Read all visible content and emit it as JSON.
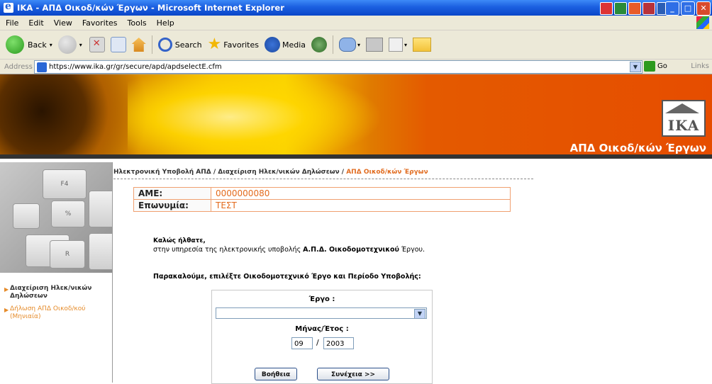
{
  "window": {
    "title": "IKA - ΑΠΔ Οικοδ/κών Έργων - Microsoft Internet Explorer"
  },
  "menu": [
    "File",
    "Edit",
    "View",
    "Favorites",
    "Tools",
    "Help"
  ],
  "toolbar": {
    "back": "Back",
    "search": "Search",
    "favorites": "Favorites",
    "media": "Media"
  },
  "address": {
    "label": "Address",
    "url": "https://www.ika.gr/gr/secure/apd/apdselectE.cfm",
    "go": "Go",
    "links": "Links"
  },
  "banner": {
    "logo_text": "IKA",
    "title": "ΑΠΔ Οικοδ/κών Έργων"
  },
  "breadcrumb": {
    "part1": "Ηλεκτρονική Υποβολή ΑΠΔ / ",
    "part2": "Διαχείριση Ηλεκ/νικών Δηλώσεων / ",
    "current": "ΑΠΔ Οικοδ/κών Έργων"
  },
  "info": {
    "ame_label": "AME:",
    "ame_value": "0000000080",
    "name_label": "Επωνυμία:",
    "name_value": "ΤΕΣΤ"
  },
  "welcome": {
    "title": "Καλώς ήλθατε,",
    "text_before": "στην υπηρεσία της ηλεκτρονικής υποβολής ",
    "text_bold": "Α.Π.Δ. Οικοδομοτεχνικού",
    "text_after": " Έργου."
  },
  "prompt": "Παρακαλούμε, επιλέξτε Οικοδομοτεχνικό Έργο και Περίοδο Υποβολής:",
  "form": {
    "ergo_label": "Έργο :",
    "ergo_value": "",
    "month_label": "Μήνας/Έτος :",
    "month": "09",
    "separator": "/",
    "year": "2003",
    "help_button": "Βοήθεια",
    "next_button": "Συνέχεια >>"
  },
  "sidebar": {
    "items": [
      {
        "label": "Διαχείριση Ηλεκ/νικών Δηλώσεων",
        "color": "#333333"
      },
      {
        "label": "Δήλωση ΑΠΔ Οικοδ/κού (Μηνιαία)",
        "color": "#e58b2a"
      }
    ]
  },
  "keyboard_keys": [
    "F4",
    "%",
    "R"
  ],
  "colors": {
    "accent": "#e16c20",
    "titlebar": "#1b5fe0",
    "banner": "#e64d00"
  }
}
